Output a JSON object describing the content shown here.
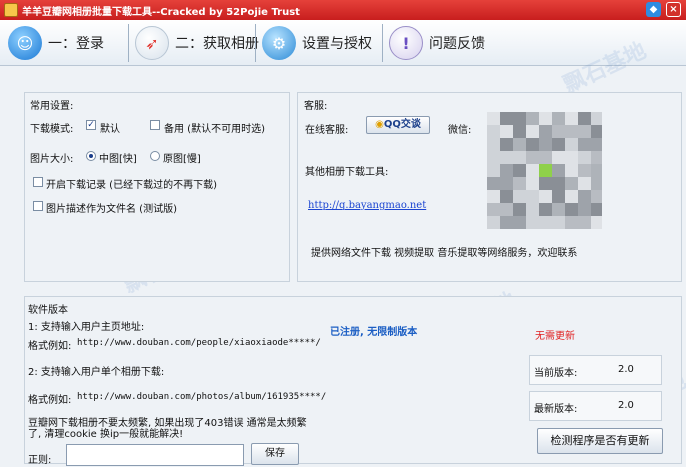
{
  "window": {
    "title": "羊羊豆瓣网相册批量下载工具--Cracked by 52Pojie Trust"
  },
  "nav": {
    "items": [
      {
        "label": "一：登录"
      },
      {
        "label": "二：获取相册"
      },
      {
        "label": "设置与授权"
      },
      {
        "label": "问题反馈"
      }
    ]
  },
  "settings": {
    "group_title": "常用设置:",
    "download_mode_label": "下载模式:",
    "default_option": "默认",
    "backup_option": "备用 (默认不可用时选)",
    "image_size_label": "图片大小:",
    "size_medium": "中图[快]",
    "size_original": "原图[慢]",
    "download_log": "开启下载记录 (已经下载过的不再下载)",
    "desc_filename": "图片描述作为文件名 (测试版)"
  },
  "support": {
    "group_title": "客服:",
    "online_label": "在线客服:",
    "qq_button": "QQ交谈",
    "wechat_label": "微信:",
    "other_tools_label": "其他相册下载工具:",
    "link": "http://q.bayangmao.net",
    "services_text": "提供网络文件下载 视频提取  音乐提取等网络服务，欢迎联系"
  },
  "version": {
    "group_title": "软件版本",
    "line1": "1: 支持输入用户主页地址:",
    "example1_label": "格式例如:",
    "example1": "http://www.douban.com/people/xiaoxiaode*****/",
    "line2": "2: 支持输入用户单个相册下载:",
    "example2_label": "格式例如:",
    "example2": "http://www.douban.com/photos/album/161935****/",
    "warning": "豆瓣网下载相册不要太频繁, 如果出现了403错误 通常是太频繁了, 清理cookie 换ip一般就能解决!",
    "regex_label": "正则:",
    "regex_value": "",
    "save_button": "保存",
    "registered_text": "已注册, 无限制版本",
    "no_update_text": "无需更新",
    "current_version_label": "当前版本:",
    "current_version": "2.0",
    "latest_version_label": "最新版本:",
    "latest_version": "2.0",
    "check_update_button": "检测程序是否有更新"
  },
  "colors": {
    "titlebar": "#d62a25",
    "registered": "#1b5ec4",
    "no_update": "#e02020",
    "link": "#1b45d1"
  }
}
